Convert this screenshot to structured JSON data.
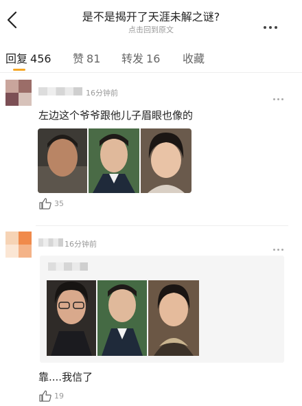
{
  "header": {
    "title": "是不是揭开了天涯未解之谜?",
    "subtitle": "点击回到原文"
  },
  "tabs": [
    {
      "label": "回复",
      "count": "456"
    },
    {
      "label": "赞",
      "count": "81"
    },
    {
      "label": "转发",
      "count": "16"
    },
    {
      "label": "收藏",
      "count": ""
    }
  ],
  "comments": [
    {
      "time": "16分钟前",
      "text": "左边这个爷爷跟他儿子眉眼也像的",
      "likes": "35"
    },
    {
      "time": "16分钟前",
      "text": "靠....我信了",
      "likes": "19"
    }
  ],
  "colors": {
    "accent": "#f5a623",
    "muted": "#999999"
  }
}
